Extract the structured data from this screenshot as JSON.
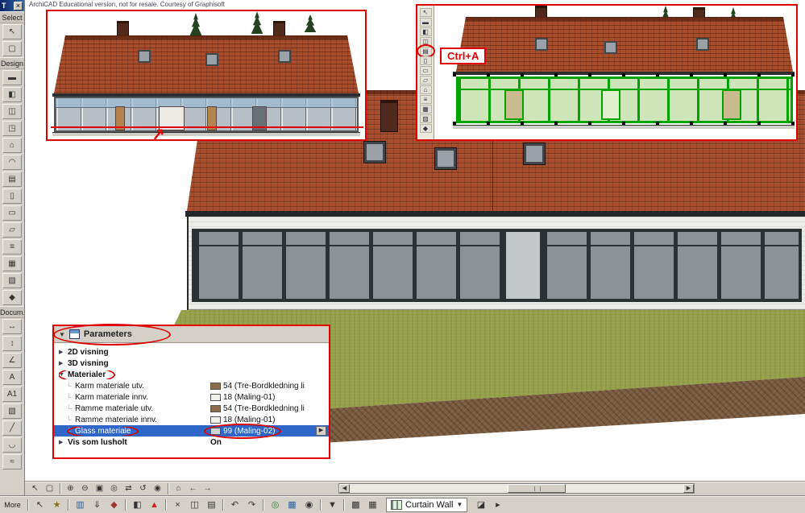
{
  "credit": "ArchiCAD Educational version, not for resale. Courtesy of Graphisoft",
  "colors": {
    "annotation_red": "#e00000",
    "selection_green": "#00a400",
    "roof_red": "#a84d2c",
    "grass_green": "#95a148",
    "soil_brown": "#7b5c41",
    "selected_row_blue": "#2e66c9"
  },
  "palette": {
    "title": "T",
    "close_glyph": "×",
    "select_label": "Select",
    "design_label": "Design",
    "document_label": "Docum...",
    "more_label": "More",
    "select_tools": [
      {
        "name": "arrow-tool-icon",
        "glyph": "↖"
      },
      {
        "name": "marquee-tool-icon",
        "glyph": "▢"
      }
    ],
    "design_tools": [
      {
        "name": "wall-tool-icon",
        "glyph": "▬"
      },
      {
        "name": "door-tool-icon",
        "glyph": "◧"
      },
      {
        "name": "window-tool-icon",
        "glyph": "◫"
      },
      {
        "name": "skylight-tool-icon",
        "glyph": "◳"
      },
      {
        "name": "roof-tool-icon",
        "glyph": "⌂"
      },
      {
        "name": "shell-tool-icon",
        "glyph": "◠"
      },
      {
        "name": "curtain-wall-tool-icon",
        "glyph": "▤"
      },
      {
        "name": "column-tool-icon",
        "glyph": "▯"
      },
      {
        "name": "beam-tool-icon",
        "glyph": "▭"
      },
      {
        "name": "slab-tool-icon",
        "glyph": "▱"
      },
      {
        "name": "stair-tool-icon",
        "glyph": "≡"
      },
      {
        "name": "mesh-tool-icon",
        "glyph": "▦"
      },
      {
        "name": "zone-tool-icon",
        "glyph": "▨"
      },
      {
        "name": "object-tool-icon",
        "glyph": "◆"
      }
    ],
    "document_tools": [
      {
        "name": "dimension-tool-icon",
        "glyph": "↔"
      },
      {
        "name": "level-dimension-tool-icon",
        "glyph": "↕"
      },
      {
        "name": "angle-dimension-tool-icon",
        "glyph": "∠"
      },
      {
        "name": "text-tool-icon",
        "glyph": "A"
      },
      {
        "name": "label-tool-icon",
        "glyph": "A1"
      },
      {
        "name": "fill-tool-icon",
        "glyph": "▧"
      },
      {
        "name": "line-tool-icon",
        "glyph": "╱"
      },
      {
        "name": "arc-tool-icon",
        "glyph": "◡"
      },
      {
        "name": "spline-tool-icon",
        "glyph": "≈"
      }
    ]
  },
  "annotations": {
    "ctrl_a_label": "Ctrl+A",
    "arrow_glyph": "↗"
  },
  "inset_toolbar": {
    "tools": [
      {
        "name": "mini-arrow-tool-icon",
        "glyph": "↖"
      },
      {
        "name": "mini-wall-tool-icon",
        "glyph": "▬"
      },
      {
        "name": "mini-door-tool-icon",
        "glyph": "◧"
      },
      {
        "name": "mini-window-tool-icon",
        "glyph": "◫"
      },
      {
        "name": "mini-curtain-wall-tool-icon",
        "glyph": "▤",
        "circled": true
      },
      {
        "name": "mini-column-tool-icon",
        "glyph": "▯"
      },
      {
        "name": "mini-beam-tool-icon",
        "glyph": "▭"
      },
      {
        "name": "mini-slab-tool-icon",
        "glyph": "▱"
      },
      {
        "name": "mini-roof-tool-icon",
        "glyph": "⌂"
      },
      {
        "name": "mini-stair-tool-icon",
        "glyph": "≡"
      },
      {
        "name": "mini-mesh-tool-icon",
        "glyph": "▦"
      },
      {
        "name": "mini-zone-tool-icon",
        "glyph": "▨"
      },
      {
        "name": "mini-object-tool-icon",
        "glyph": "◆"
      }
    ]
  },
  "parameters_panel": {
    "header": "Parameters",
    "header_collapse_glyph": "▼",
    "rows": [
      {
        "name": "param-row-2d-visning",
        "kind": "group",
        "arrow": "▶",
        "label": "2D visning"
      },
      {
        "name": "param-row-3d-visning",
        "kind": "group",
        "arrow": "▶",
        "label": "3D visning"
      },
      {
        "name": "param-row-materialer",
        "kind": "group",
        "arrow": "▼",
        "label": "Materialer",
        "circled": true
      },
      {
        "name": "param-row-karm-materiale-utv",
        "kind": "child",
        "tree": "└",
        "label": "Karm materiale utv.",
        "swatch": "#8a6b4a",
        "value": "54 (Tre-Bordkledning li"
      },
      {
        "name": "param-row-karm-materiale-innv",
        "kind": "child",
        "tree": "└",
        "label": "Karm materiale innv.",
        "swatch": "#f2f2ec",
        "value": "18 (Maling-01)"
      },
      {
        "name": "param-row-ramme-materiale-utv",
        "kind": "child",
        "tree": "└",
        "label": "Ramme materiale utv.",
        "swatch": "#8a6b4a",
        "value": "54 (Tre-Bordkledning li"
      },
      {
        "name": "param-row-ramme-materiale-innv",
        "kind": "child",
        "tree": "└",
        "label": "Ramme materiale innv.",
        "swatch": "#f2f2ec",
        "value": "18 (Maling-01)"
      },
      {
        "name": "param-row-glass-materiale",
        "kind": "child",
        "tree": "└",
        "label": "Glass materiale",
        "swatch": "#cfd4d6",
        "value": "99 (Maling-02)",
        "selected": true,
        "spinner": "▶"
      },
      {
        "name": "param-row-vis-som",
        "kind": "group",
        "arrow": "▶",
        "label": "Vis som lusholt",
        "value": "On"
      }
    ]
  },
  "statusbar": {
    "scroll_left_glyph": "◀",
    "scroll_right_glyph": "▶",
    "tools": [
      {
        "name": "selection-arrow-icon",
        "glyph": "↖"
      },
      {
        "name": "marquee-select-icon",
        "glyph": "▢"
      },
      {
        "sep": true
      },
      {
        "name": "zoom-in-icon",
        "glyph": "⊕"
      },
      {
        "name": "zoom-out-icon",
        "glyph": "⊖"
      },
      {
        "name": "fit-in-window-icon",
        "glyph": "▣"
      },
      {
        "name": "zoom-previous-icon",
        "glyph": "◎"
      },
      {
        "name": "pan-icon",
        "glyph": "⇄"
      },
      {
        "name": "orbit-icon",
        "glyph": "↺"
      },
      {
        "name": "explore-icon",
        "glyph": "◉"
      },
      {
        "sep": true
      },
      {
        "name": "home-view-icon",
        "glyph": "⌂"
      },
      {
        "name": "previous-view-icon",
        "glyph": "←"
      },
      {
        "name": "next-view-icon",
        "glyph": "→"
      }
    ]
  },
  "bottombar": {
    "curtain_wall": {
      "label": "Curtain Wall",
      "dropdown_glyph": "▼"
    },
    "tools_left": [
      {
        "name": "options-icon",
        "glyph": "↖"
      },
      {
        "name": "favorites-icon",
        "glyph": "★",
        "tint": "#8a6d1a"
      },
      {
        "sep": true
      },
      {
        "name": "layers-icon",
        "glyph": "▥",
        "tint": "#2b5fa3"
      },
      {
        "name": "gravity-icon",
        "glyph": "⇓"
      },
      {
        "name": "snap-icon",
        "glyph": "◆",
        "tint": "#a33333"
      },
      {
        "sep": true
      },
      {
        "name": "groups-icon",
        "glyph": "◧"
      },
      {
        "name": "flag-icon",
        "glyph": "▲",
        "tint": "#cc2222"
      },
      {
        "sep": true
      },
      {
        "name": "cut-icon",
        "glyph": "×"
      },
      {
        "name": "copy-icon",
        "glyph": "◫"
      },
      {
        "name": "paste-icon",
        "glyph": "▤"
      },
      {
        "sep": true
      },
      {
        "name": "undo-icon",
        "glyph": "↶"
      },
      {
        "name": "redo-icon",
        "glyph": "↷"
      },
      {
        "sep": true
      },
      {
        "name": "teamwork-icon",
        "glyph": "◎",
        "tint": "#2b7f3a"
      },
      {
        "name": "publisher-icon",
        "glyph": "▦",
        "tint": "#2b5fa3"
      },
      {
        "name": "3d-window-icon",
        "glyph": "◉"
      },
      {
        "sep": true
      },
      {
        "name": "3d-visualization-dropdown-icon",
        "glyph": "▼"
      },
      {
        "sep": true
      },
      {
        "name": "element-settings-icon",
        "glyph": "▩"
      },
      {
        "name": "grid-icon",
        "glyph": "▦"
      }
    ],
    "tools_right": [
      {
        "name": "info-box-icon",
        "glyph": "◪"
      },
      {
        "name": "quick-options-icon",
        "glyph": "▸"
      }
    ]
  }
}
